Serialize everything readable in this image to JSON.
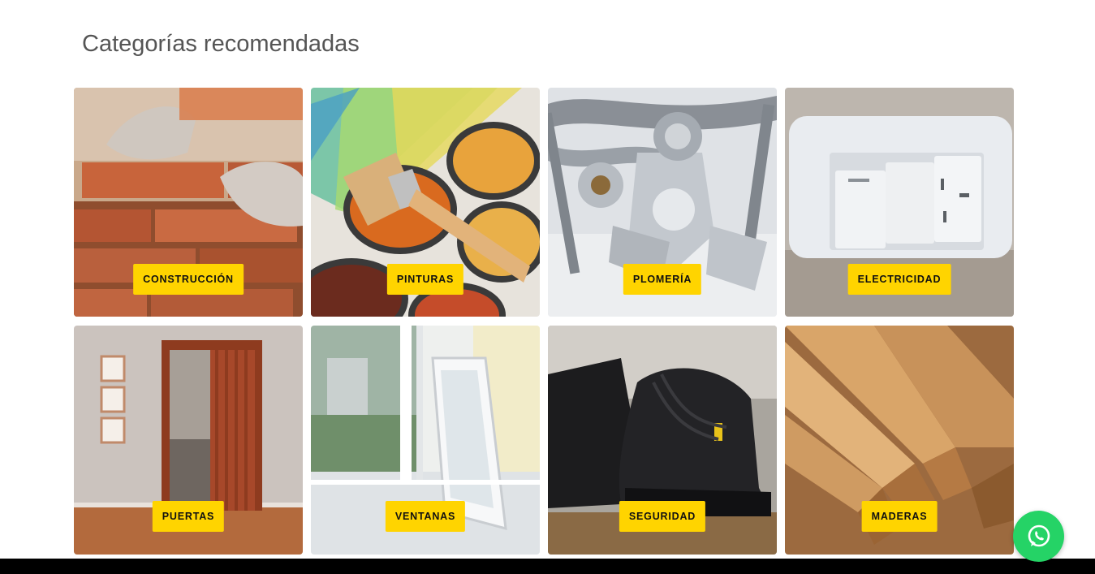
{
  "section": {
    "title": "Categorías recomendadas"
  },
  "categories": [
    {
      "label": "CONSTRUCCIÓN",
      "image": "bricklaying-photo"
    },
    {
      "label": "PINTURAS",
      "image": "paint-cans-photo"
    },
    {
      "label": "PLOMERÍA",
      "image": "plumbing-fittings-photo"
    },
    {
      "label": "ELECTRICIDAD",
      "image": "wall-switch-outlet-photo"
    },
    {
      "label": "PUERTAS",
      "image": "folding-door-photo"
    },
    {
      "label": "VENTANAS",
      "image": "window-frame-photo"
    },
    {
      "label": "SEGURIDAD",
      "image": "safety-boots-photo"
    },
    {
      "label": "MADERAS",
      "image": "lumber-photo"
    }
  ],
  "whatsapp": {
    "icon": "whatsapp-icon"
  },
  "colors": {
    "tag_bg": "#ffd400",
    "whatsapp_bg": "#25d366",
    "title": "#555555"
  }
}
